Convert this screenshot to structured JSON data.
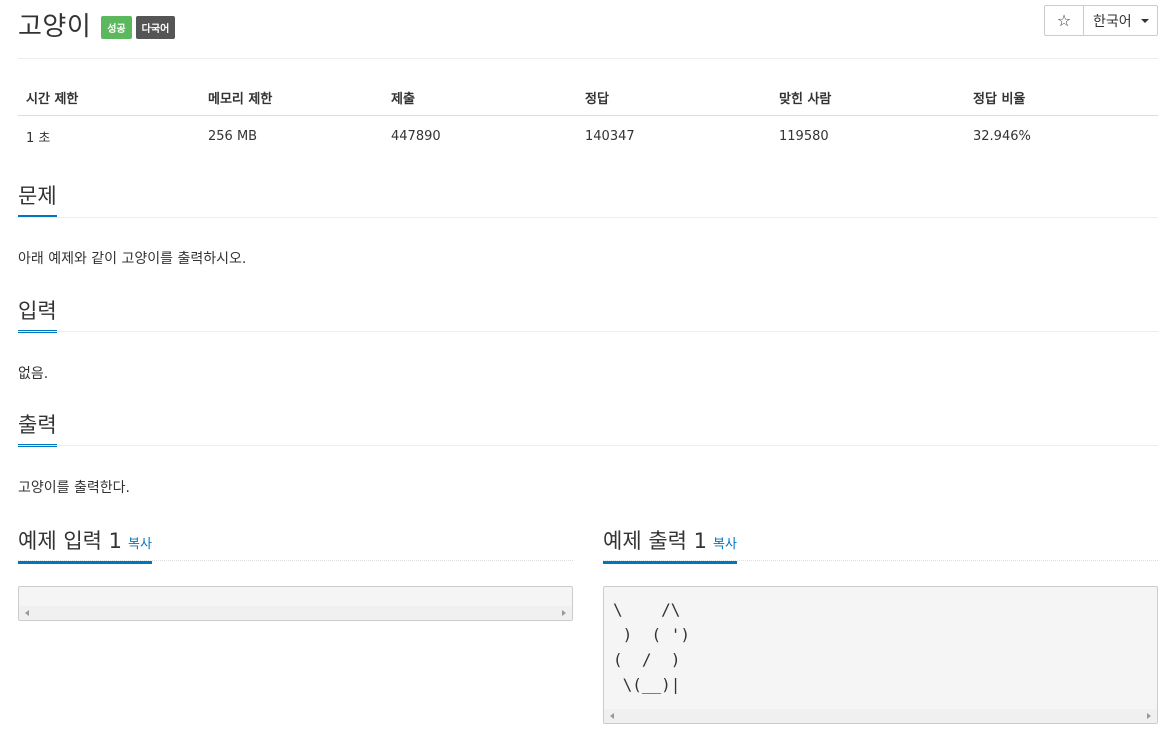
{
  "problem": {
    "title": "고양이",
    "badges": {
      "success": "성공",
      "multilang": "다국어"
    }
  },
  "toolbar": {
    "star_icon": "☆",
    "language": "한국어"
  },
  "info_table": {
    "headers": [
      "시간 제한",
      "메모리 제한",
      "제출",
      "정답",
      "맞힌 사람",
      "정답 비율"
    ],
    "values": [
      "1 초",
      "256 MB",
      "447890",
      "140347",
      "119580",
      "32.946%"
    ]
  },
  "sections": {
    "problem": {
      "title": "문제",
      "text": "아래 예제와 같이 고양이를 출력하시오."
    },
    "input": {
      "title": "입력",
      "text": "없음."
    },
    "output": {
      "title": "출력",
      "text": "고양이를 출력한다."
    }
  },
  "examples": {
    "input": {
      "title": "예제 입력 1",
      "copy": "복사",
      "content": ""
    },
    "output": {
      "title": "예제 출력 1",
      "copy": "복사",
      "content": "\\    /\\\n )  ( ')\n(  /  )\n \\(__)|"
    }
  },
  "colors": {
    "accent": "#0076c0",
    "success": "#5cb85c",
    "multilang": "#555555"
  }
}
